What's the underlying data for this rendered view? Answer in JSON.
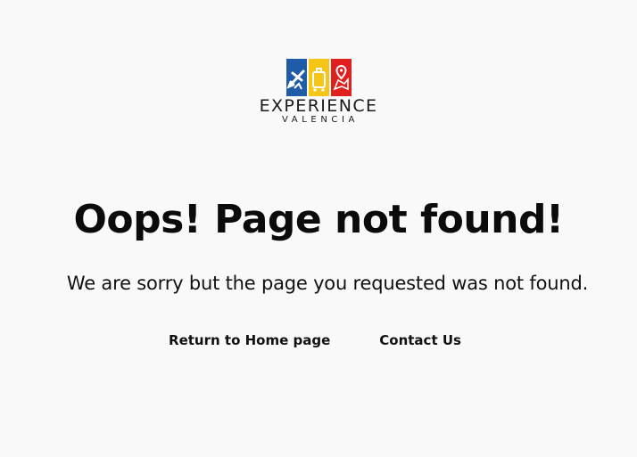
{
  "logo": {
    "word": "EXPERIENCE",
    "sub": "VALENCIA",
    "tiles": [
      {
        "icon": "airplane-icon",
        "color": "#1f5ca8"
      },
      {
        "icon": "suitcase-icon",
        "color": "#f5c518"
      },
      {
        "icon": "map-pin-icon",
        "color": "#e0201f"
      }
    ]
  },
  "error": {
    "title": "Oops! Page not found!",
    "message": "We are sorry but the page you requested was not found."
  },
  "links": {
    "home": "Return to Home page",
    "contact": "Contact Us"
  },
  "colors": {
    "background": "#f9f9f9",
    "text": "#111111"
  }
}
